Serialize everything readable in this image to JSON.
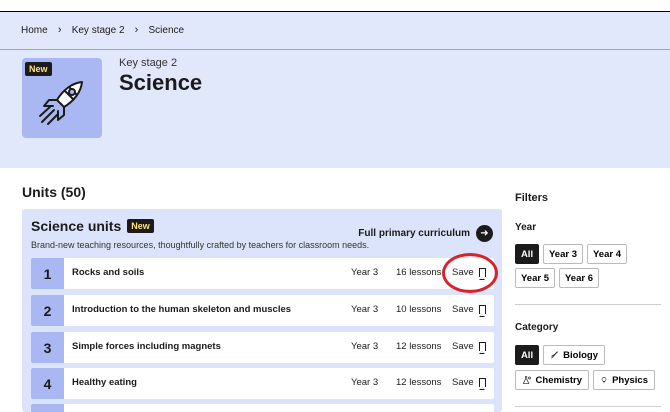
{
  "breadcrumb": [
    "Home",
    "Key stage 2",
    "Science"
  ],
  "hero": {
    "key_stage": "Key stage 2",
    "title": "Science",
    "badge": "New",
    "bg_color": "#e1e8fb",
    "image_color": "#a9b8f3",
    "image_icon": "rocket-icon"
  },
  "units": {
    "heading": "Units (50)",
    "panel": {
      "title": "Science units",
      "badge": "New",
      "description": "Brand-new teaching resources, thoughtfully crafted by teachers for classroom needs.",
      "full_curriculum_label": "Full primary curriculum"
    },
    "rows": [
      {
        "number": "1",
        "title": "Rocks and soils",
        "year": "Year 3",
        "lessons": "16 lessons",
        "save": "Save"
      },
      {
        "number": "2",
        "title": "Introduction to the human skeleton and muscles",
        "year": "Year 3",
        "lessons": "10 lessons",
        "save": "Save"
      },
      {
        "number": "3",
        "title": "Simple forces including magnets",
        "year": "Year 3",
        "lessons": "12 lessons",
        "save": "Save"
      },
      {
        "number": "4",
        "title": "Healthy eating",
        "year": "Year 3",
        "lessons": "12 lessons",
        "save": "Save"
      }
    ]
  },
  "filters": {
    "title": "Filters",
    "year": {
      "label": "Year",
      "options": [
        "All",
        "Year 3",
        "Year 4",
        "Year 5",
        "Year 6"
      ],
      "selected": "All"
    },
    "category": {
      "label": "Category",
      "options": [
        "All",
        "Biology",
        "Chemistry",
        "Physics"
      ],
      "selected": "All",
      "icons": [
        "",
        "dna-icon",
        "flask-icon",
        "lightbulb-icon"
      ]
    }
  },
  "colors": {
    "accent_dark": "#1b1b1b",
    "badge_text": "#ffe27a",
    "highlight_circle": "#d8232a",
    "panel_bg": "#dce4fb"
  }
}
